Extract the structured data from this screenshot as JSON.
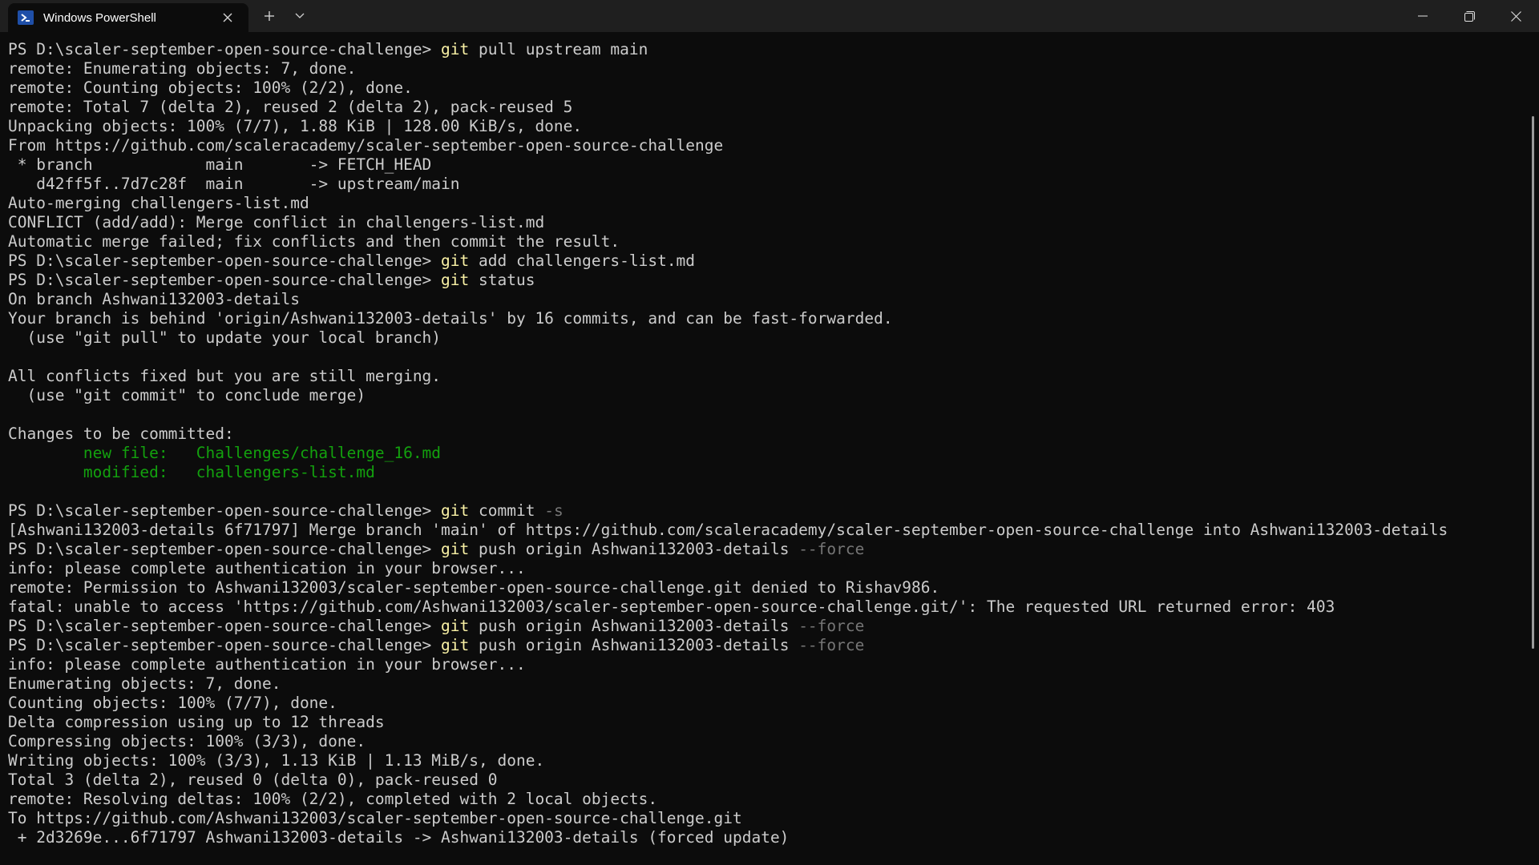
{
  "titlebar": {
    "tab_title": "Windows PowerShell",
    "tab_icon": "powershell-icon",
    "new_tab_icon": "plus-icon",
    "dropdown_icon": "chevron-down-icon",
    "close_tab_icon": "close-icon",
    "window_controls": [
      "minimize-icon",
      "restore-icon",
      "close-icon"
    ]
  },
  "colors": {
    "background": "#0c0c0c",
    "text": "#cccccc",
    "command": "#f9f1a5",
    "parameter": "#767676",
    "staged": "#13a10e"
  },
  "terminal": {
    "lines": [
      {
        "segments": [
          {
            "t": "PS D:\\scaler-september-open-source-challenge> ",
            "c": ""
          },
          {
            "t": "git",
            "c": "cmd"
          },
          {
            "t": " pull upstream main",
            "c": ""
          }
        ]
      },
      {
        "segments": [
          {
            "t": "remote: Enumerating objects: 7, done.",
            "c": ""
          }
        ]
      },
      {
        "segments": [
          {
            "t": "remote: Counting objects: 100% (2/2), done.",
            "c": ""
          }
        ]
      },
      {
        "segments": [
          {
            "t": "remote: Total 7 (delta 2), reused 2 (delta 2), pack-reused 5",
            "c": ""
          }
        ]
      },
      {
        "segments": [
          {
            "t": "Unpacking objects: 100% (7/7), 1.88 KiB | 128.00 KiB/s, done.",
            "c": ""
          }
        ]
      },
      {
        "segments": [
          {
            "t": "From https://github.com/scaleracademy/scaler-september-open-source-challenge",
            "c": ""
          }
        ]
      },
      {
        "segments": [
          {
            "t": " * branch            main       -> FETCH_HEAD",
            "c": ""
          }
        ]
      },
      {
        "segments": [
          {
            "t": "   d42ff5f..7d7c28f  main       -> upstream/main",
            "c": ""
          }
        ]
      },
      {
        "segments": [
          {
            "t": "Auto-merging challengers-list.md",
            "c": ""
          }
        ]
      },
      {
        "segments": [
          {
            "t": "CONFLICT (add/add): Merge conflict in challengers-list.md",
            "c": ""
          }
        ]
      },
      {
        "segments": [
          {
            "t": "Automatic merge failed; fix conflicts and then commit the result.",
            "c": ""
          }
        ]
      },
      {
        "segments": [
          {
            "t": "PS D:\\scaler-september-open-source-challenge> ",
            "c": ""
          },
          {
            "t": "git",
            "c": "cmd"
          },
          {
            "t": " add challengers-list.md",
            "c": ""
          }
        ]
      },
      {
        "segments": [
          {
            "t": "PS D:\\scaler-september-open-source-challenge> ",
            "c": ""
          },
          {
            "t": "git",
            "c": "cmd"
          },
          {
            "t": " status",
            "c": ""
          }
        ]
      },
      {
        "segments": [
          {
            "t": "On branch Ashwani132003-details",
            "c": ""
          }
        ]
      },
      {
        "segments": [
          {
            "t": "Your branch is behind 'origin/Ashwani132003-details' by 16 commits, and can be fast-forwarded.",
            "c": ""
          }
        ]
      },
      {
        "segments": [
          {
            "t": "  (use \"git pull\" to update your local branch)",
            "c": ""
          }
        ]
      },
      {
        "segments": [
          {
            "t": "",
            "c": ""
          }
        ]
      },
      {
        "segments": [
          {
            "t": "All conflicts fixed but you are still merging.",
            "c": ""
          }
        ]
      },
      {
        "segments": [
          {
            "t": "  (use \"git commit\" to conclude merge)",
            "c": ""
          }
        ]
      },
      {
        "segments": [
          {
            "t": "",
            "c": ""
          }
        ]
      },
      {
        "segments": [
          {
            "t": "Changes to be committed:",
            "c": ""
          }
        ]
      },
      {
        "segments": [
          {
            "t": "        ",
            "c": ""
          },
          {
            "t": "new file:   Challenges/challenge_16.md",
            "c": "green"
          }
        ]
      },
      {
        "segments": [
          {
            "t": "        ",
            "c": ""
          },
          {
            "t": "modified:   challengers-list.md",
            "c": "green"
          }
        ]
      },
      {
        "segments": [
          {
            "t": "",
            "c": ""
          }
        ]
      },
      {
        "segments": [
          {
            "t": "PS D:\\scaler-september-open-source-challenge> ",
            "c": ""
          },
          {
            "t": "git",
            "c": "cmd"
          },
          {
            "t": " commit ",
            "c": ""
          },
          {
            "t": "-s",
            "c": "param"
          }
        ]
      },
      {
        "segments": [
          {
            "t": "[Ashwani132003-details 6f71797] Merge branch 'main' of https://github.com/scaleracademy/scaler-september-open-source-challenge into Ashwani132003-details",
            "c": ""
          }
        ]
      },
      {
        "segments": [
          {
            "t": "PS D:\\scaler-september-open-source-challenge> ",
            "c": ""
          },
          {
            "t": "git",
            "c": "cmd"
          },
          {
            "t": " push origin Ashwani132003-details ",
            "c": ""
          },
          {
            "t": "--force",
            "c": "param"
          }
        ]
      },
      {
        "segments": [
          {
            "t": "info: please complete authentication in your browser...",
            "c": ""
          }
        ]
      },
      {
        "segments": [
          {
            "t": "remote: Permission to Ashwani132003/scaler-september-open-source-challenge.git denied to Rishav986.",
            "c": ""
          }
        ]
      },
      {
        "segments": [
          {
            "t": "fatal: unable to access 'https://github.com/Ashwani132003/scaler-september-open-source-challenge.git/': The requested URL returned error: 403",
            "c": ""
          }
        ]
      },
      {
        "segments": [
          {
            "t": "PS D:\\scaler-september-open-source-challenge> ",
            "c": ""
          },
          {
            "t": "git",
            "c": "cmd"
          },
          {
            "t": " push origin Ashwani132003-details ",
            "c": ""
          },
          {
            "t": "--force",
            "c": "param"
          }
        ]
      },
      {
        "segments": [
          {
            "t": "PS D:\\scaler-september-open-source-challenge> ",
            "c": ""
          },
          {
            "t": "git",
            "c": "cmd"
          },
          {
            "t": " push origin Ashwani132003-details ",
            "c": ""
          },
          {
            "t": "--force",
            "c": "param"
          }
        ]
      },
      {
        "segments": [
          {
            "t": "info: please complete authentication in your browser...",
            "c": ""
          }
        ]
      },
      {
        "segments": [
          {
            "t": "Enumerating objects: 7, done.",
            "c": ""
          }
        ]
      },
      {
        "segments": [
          {
            "t": "Counting objects: 100% (7/7), done.",
            "c": ""
          }
        ]
      },
      {
        "segments": [
          {
            "t": "Delta compression using up to 12 threads",
            "c": ""
          }
        ]
      },
      {
        "segments": [
          {
            "t": "Compressing objects: 100% (3/3), done.",
            "c": ""
          }
        ]
      },
      {
        "segments": [
          {
            "t": "Writing objects: 100% (3/3), 1.13 KiB | 1.13 MiB/s, done.",
            "c": ""
          }
        ]
      },
      {
        "segments": [
          {
            "t": "Total 3 (delta 2), reused 0 (delta 0), pack-reused 0",
            "c": ""
          }
        ]
      },
      {
        "segments": [
          {
            "t": "remote: Resolving deltas: 100% (2/2), completed with 2 local objects.",
            "c": ""
          }
        ]
      },
      {
        "segments": [
          {
            "t": "To https://github.com/Ashwani132003/scaler-september-open-source-challenge.git",
            "c": ""
          }
        ]
      },
      {
        "segments": [
          {
            "t": " + 2d3269e...6f71797 Ashwani132003-details -> Ashwani132003-details (forced update)",
            "c": ""
          }
        ]
      }
    ]
  }
}
